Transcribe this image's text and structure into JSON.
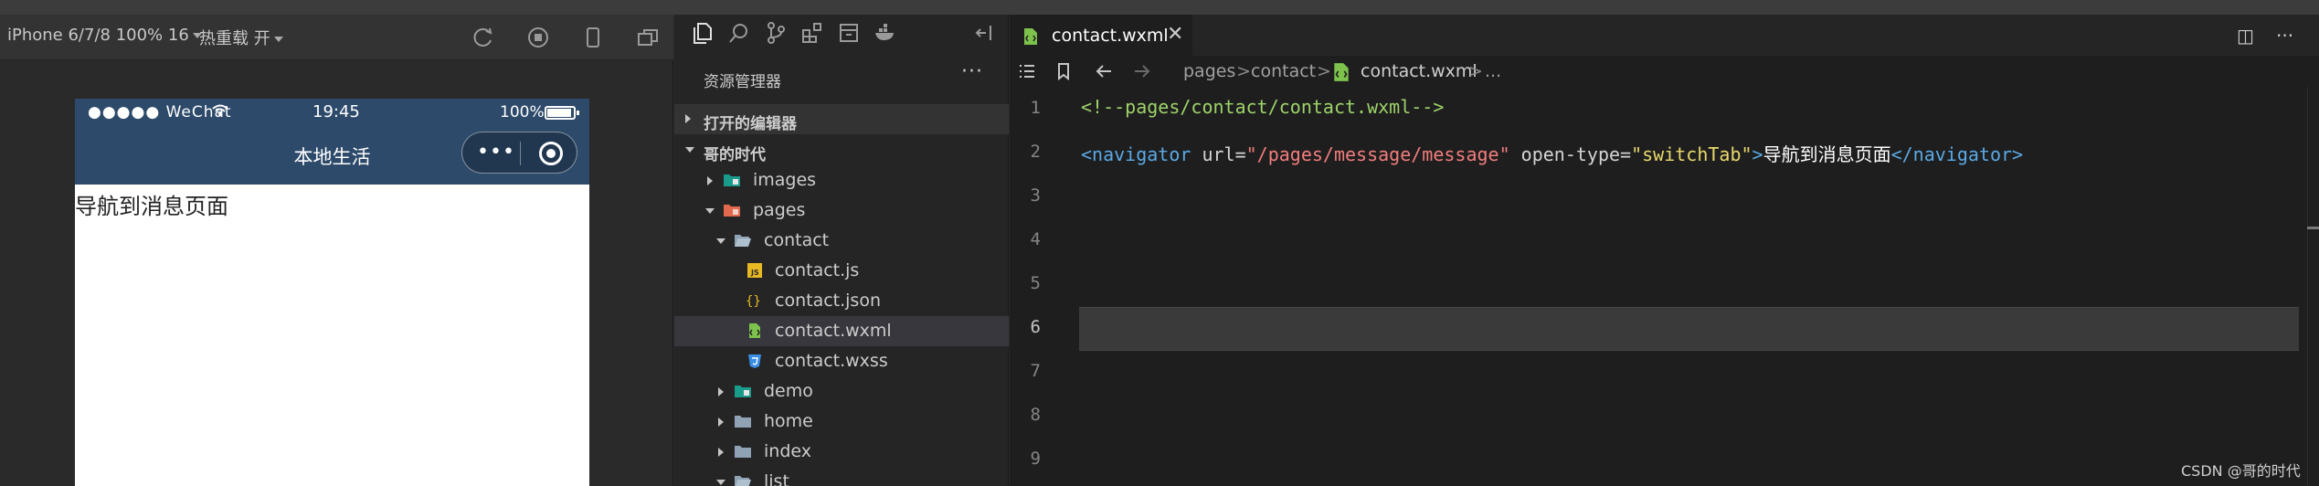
{
  "simulator": {
    "device": "iPhone 6/7/8 100% 16",
    "hot_reload": "热重载 开",
    "phone": {
      "carrier": "●●●●● WeChat",
      "time": "19:45",
      "battery_pct": "100%",
      "nav_title": "本地生活",
      "capsule_more": "•••",
      "page_text": "导航到消息页面"
    }
  },
  "explorer": {
    "title": "资源管理器",
    "more": "···",
    "section_open_editors": "打开的编辑器",
    "section_project": "哥的时代",
    "tree": [
      {
        "label": "images",
        "kind": "folder",
        "state": "collapsed"
      },
      {
        "label": "pages",
        "kind": "folder",
        "state": "expanded"
      },
      {
        "label": "contact",
        "kind": "folder",
        "state": "expanded"
      },
      {
        "label": "contact.js",
        "kind": "js"
      },
      {
        "label": "contact.json",
        "kind": "json"
      },
      {
        "label": "contact.wxml",
        "kind": "wxml",
        "active": true
      },
      {
        "label": "contact.wxss",
        "kind": "wxss"
      },
      {
        "label": "demo",
        "kind": "folder",
        "state": "collapsed"
      },
      {
        "label": "home",
        "kind": "folder",
        "state": "collapsed"
      },
      {
        "label": "index",
        "kind": "folder",
        "state": "collapsed"
      },
      {
        "label": "list",
        "kind": "folder",
        "state": "expanded"
      }
    ]
  },
  "editor": {
    "tab_label": "contact.wxml",
    "tab_close": "✕",
    "split_icon": "◫",
    "more": "···",
    "breadcrumb": [
      "pages",
      "contact",
      "contact.wxml",
      "..."
    ],
    "line_numbers": [
      "1",
      "2",
      "3",
      "4",
      "5",
      "6",
      "7",
      "8",
      "9"
    ],
    "current_line": 6,
    "code": {
      "line1": "<!--pages/contact/contact.wxml-->",
      "line2": {
        "open_tag": "<navigator",
        "attr1": " url=",
        "val1": "\"/pages/message/message\"",
        "attr2": " open-type=",
        "val2": "\"switchTab\"",
        "close_bracket": ">",
        "text": "导航到消息页面",
        "end_tag": "</navigator>"
      }
    }
  },
  "watermark": "CSDN @哥的时代",
  "colors": {
    "nav_bar": "#2d4a6a",
    "comment": "#9ed36a",
    "tag": "#5aa9e6",
    "string": "#f27d7d",
    "string_alt": "#e9d86d"
  }
}
